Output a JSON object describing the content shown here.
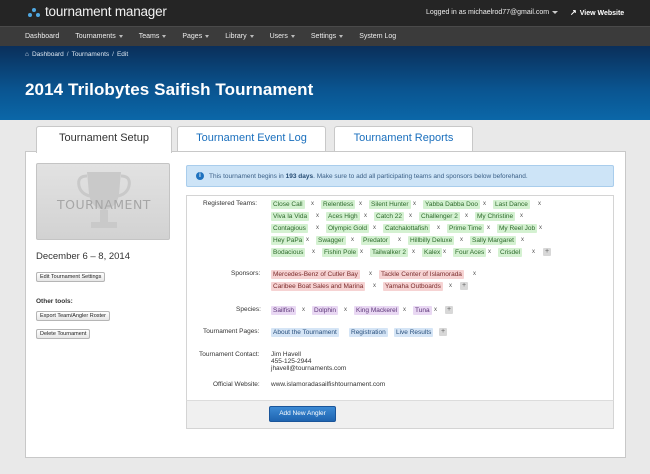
{
  "app": {
    "title": "tournament manager"
  },
  "topbar": {
    "logged_in": "Logged in as michaelrod77@gmail.com",
    "view_website": "View Website"
  },
  "nav": [
    "Dashboard",
    "Tournaments",
    "Teams",
    "Pages",
    "Library",
    "Users",
    "Settings",
    "System Log"
  ],
  "breadcrumb": [
    "Dashboard",
    "Tournaments",
    "Edit"
  ],
  "page_title": "2014 Trilobytes Saifish Tournament",
  "tabs": [
    "Tournament Setup",
    "Tournament Event Log",
    "Tournament Reports"
  ],
  "sidebar": {
    "image_text": "TOURNAMENT",
    "dates": "December 6 – 8, 2014",
    "edit_settings": "Edit Tournament Settings",
    "other_tools": "Other tools:",
    "export": "Export Team/Angler Roster",
    "delete": "Delete Tournament"
  },
  "info": {
    "before": "This tournament begins in",
    "days": "193 days",
    "after": ". Make sure to add all participating teams and sponsors below beforehand."
  },
  "labels": {
    "teams": "Registered Teams:",
    "sponsors": "Sponsors:",
    "species": "Species:",
    "pages": "Tournament Pages:",
    "contact": "Tournament Contact:",
    "website": "Official Website:"
  },
  "teams": [
    "Close Call",
    "Relentless",
    "Silent Hunter",
    "Yabba Dabba Doo",
    "Last Dance",
    "Viva la Vida",
    "Aces High",
    "Catch 22",
    "Challenger 2",
    "My Christine",
    "Contagious",
    "Olympic Gold",
    "Catchalottafish",
    "Prime Time",
    "My Reel Job",
    "Hey PaPa",
    "Swagger",
    "Predator",
    "Hillbilly Deluxe",
    "Sally Margaret",
    "Bodacious",
    "Fishin Pole",
    "Tailwalker 2",
    "Kalex",
    "Four Aces",
    "Crisdel"
  ],
  "sponsors": [
    "Mercedes-Benz of Cutler Bay",
    "Tackle Center of Islamorada",
    "Caribee Boat Sales and Marina",
    "Yamaha Outboards"
  ],
  "species": [
    "Sailfish",
    "Dolphin",
    "King Mackerel",
    "Tuna"
  ],
  "pages": [
    "About the Tournament",
    "Registration",
    "Live Results"
  ],
  "contact": {
    "name": "Jim Havell",
    "phone": "455-125-2944",
    "email": "jhavell@tournaments.com"
  },
  "website": "www.islamoradasailfishtournament.com",
  "add_angler": "Add New Angler",
  "symbols": {
    "remove": "x",
    "add": "+"
  },
  "colors": {
    "accent": "#0b67a8",
    "team_tag": "#d4f1d1",
    "sponsor_tag": "#f6d3d3",
    "species_tag": "#e9d8f3",
    "page_tag": "#d5e5f6"
  }
}
